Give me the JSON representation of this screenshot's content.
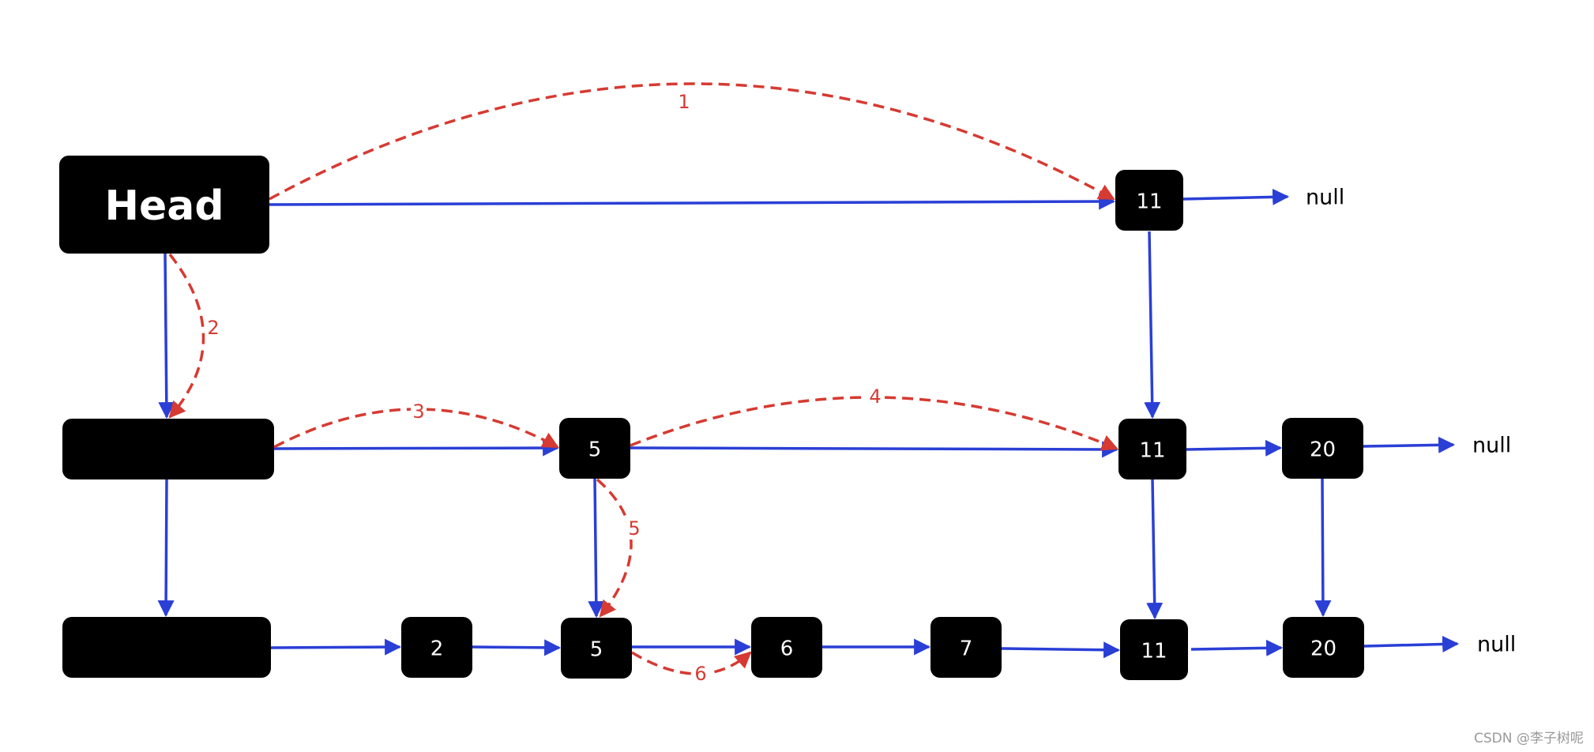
{
  "colors": {
    "node": "#000000",
    "pointer": "#2a3fd6",
    "search_path": "#d63a32",
    "background": "#ffffff"
  },
  "nodes": {
    "head": "Head",
    "level2_head": "",
    "level1_head": "",
    "top_11": "11",
    "mid_5": "5",
    "mid_11": "11",
    "mid_20": "20",
    "bot_2": "2",
    "bot_5": "5",
    "bot_6": "6",
    "bot_7": "7",
    "bot_11": "11",
    "bot_20": "20"
  },
  "nulls": {
    "top": "null",
    "mid": "null",
    "bot": "null"
  },
  "steps": [
    "1",
    "2",
    "3",
    "4",
    "5",
    "6"
  ],
  "watermark": "CSDN @李子树呢"
}
